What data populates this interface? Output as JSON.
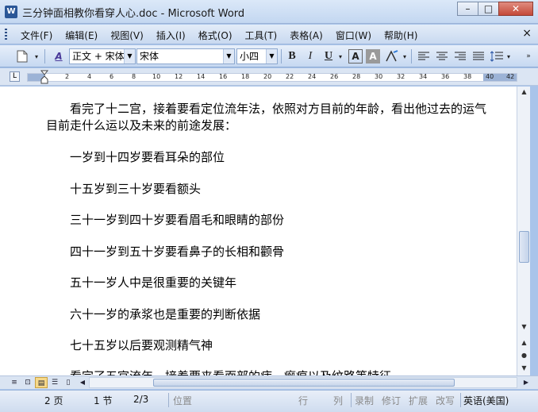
{
  "window": {
    "title": "三分钟面相教你看穿人心.doc - Microsoft Word",
    "app_icon_letter": "W",
    "minimize": "–",
    "maximize": "□",
    "close": "✕"
  },
  "menu": {
    "items": [
      "文件(F)",
      "编辑(E)",
      "视图(V)",
      "插入(I)",
      "格式(O)",
      "工具(T)",
      "表格(A)",
      "窗口(W)",
      "帮助(H)"
    ],
    "doc_close": "×"
  },
  "toolbar": {
    "style_value": "正文 + 宋体",
    "font_value": "宋体",
    "size_value": "小四",
    "bold": "B",
    "italic": "I",
    "underline": "U",
    "font_color_label": "A",
    "highlight_label": "A",
    "style_icon_label": "A"
  },
  "ruler": {
    "numbers": [
      "2",
      "4",
      "6",
      "8",
      "10",
      "12",
      "14",
      "16",
      "18",
      "20",
      "22",
      "24",
      "26",
      "28",
      "30",
      "32",
      "34",
      "36",
      "38",
      "40",
      "42"
    ],
    "tab_selector": "L"
  },
  "document": {
    "first_paragraph": "看完了十二宫，接着要看定位流年法，依照对方目前的年龄，看出他过去的运气目前走什么运以及未来的前途发展：",
    "lines": [
      "一岁到十四岁要看耳朵的部位",
      "十五岁到三十岁要看额头",
      "三十一岁到四十岁要看眉毛和眼睛的部份",
      "四十一岁到五十岁要看鼻子的长相和颧骨",
      "五十一岁人中是很重要的关键年",
      "六十一岁的承浆也是重要的判断依据",
      "七十五岁以后要观测精气神",
      "看完了五官流年，接着要来看面部的痣、瘢痕以及纹路等特征"
    ]
  },
  "status": {
    "page": "2 页",
    "section": "1 节",
    "page_of": "2/3",
    "position": "位置",
    "line": "行",
    "column": "列",
    "rec": "录制",
    "trk": "修订",
    "ext": "扩展",
    "ovr": "改写",
    "language": "英语(美国)"
  },
  "colors": {
    "accent": "#c3d7f1",
    "close_button": "#c44a39"
  }
}
